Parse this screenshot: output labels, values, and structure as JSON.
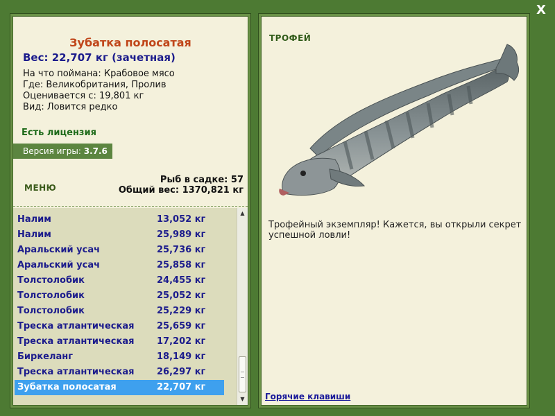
{
  "window": {
    "close_label": "X"
  },
  "fish": {
    "title": "Зубатка полосатая",
    "weight_line": "Вес: 22,707 кг (зачетная)",
    "bait_line": "На что поймана: Крабовое мясо",
    "location_line": "Где: Великобритания, Пролив",
    "value_line": "Оценивается с: 19,801 кг",
    "kind_line": "Вид: Ловится редко"
  },
  "license_label": "Есть лицензия",
  "version": {
    "label": "Версия игры:",
    "value": "3.7.6"
  },
  "menu_label": "МЕНЮ",
  "keepnet": {
    "count_line": "Рыб в садке: 57",
    "total_line": "Общий вес: 1370,821 кг"
  },
  "catch_list": [
    {
      "name": "Налим",
      "weight": "13,052 кг"
    },
    {
      "name": "Налим",
      "weight": "25,989 кг"
    },
    {
      "name": "Аральский усач",
      "weight": "25,736 кг"
    },
    {
      "name": "Аральский усач",
      "weight": "25,858 кг"
    },
    {
      "name": "Толстолобик",
      "weight": "24,455 кг"
    },
    {
      "name": "Толстолобик",
      "weight": "25,052 кг"
    },
    {
      "name": "Толстолобик",
      "weight": "25,229 кг"
    },
    {
      "name": "Треска атлантическая",
      "weight": "25,659 кг"
    },
    {
      "name": "Треска атлантическая",
      "weight": "17,202 кг"
    },
    {
      "name": "Биркеланг",
      "weight": "18,149 кг"
    },
    {
      "name": "Треска атлантическая",
      "weight": "26,297 кг"
    },
    {
      "name": "Зубатка полосатая",
      "weight": "22,707 кг",
      "selected": true
    }
  ],
  "trophy": {
    "label": "ТРОФЕЙ",
    "message": "Трофейный экземпляр! Кажется, вы открыли секрет успешной ловли!"
  },
  "hotkeys_label": "Горячие клавиши",
  "colors": {
    "frame_bg": "#4d7a33",
    "panel_bg": "#f4f1dc",
    "title": "#c0461a",
    "list_text": "#1c1c8c",
    "selection": "#3ea0ee"
  },
  "icons": {
    "close": "close-icon",
    "scroll_up": "arrow-up-icon",
    "scroll_down": "arrow-down-icon"
  }
}
